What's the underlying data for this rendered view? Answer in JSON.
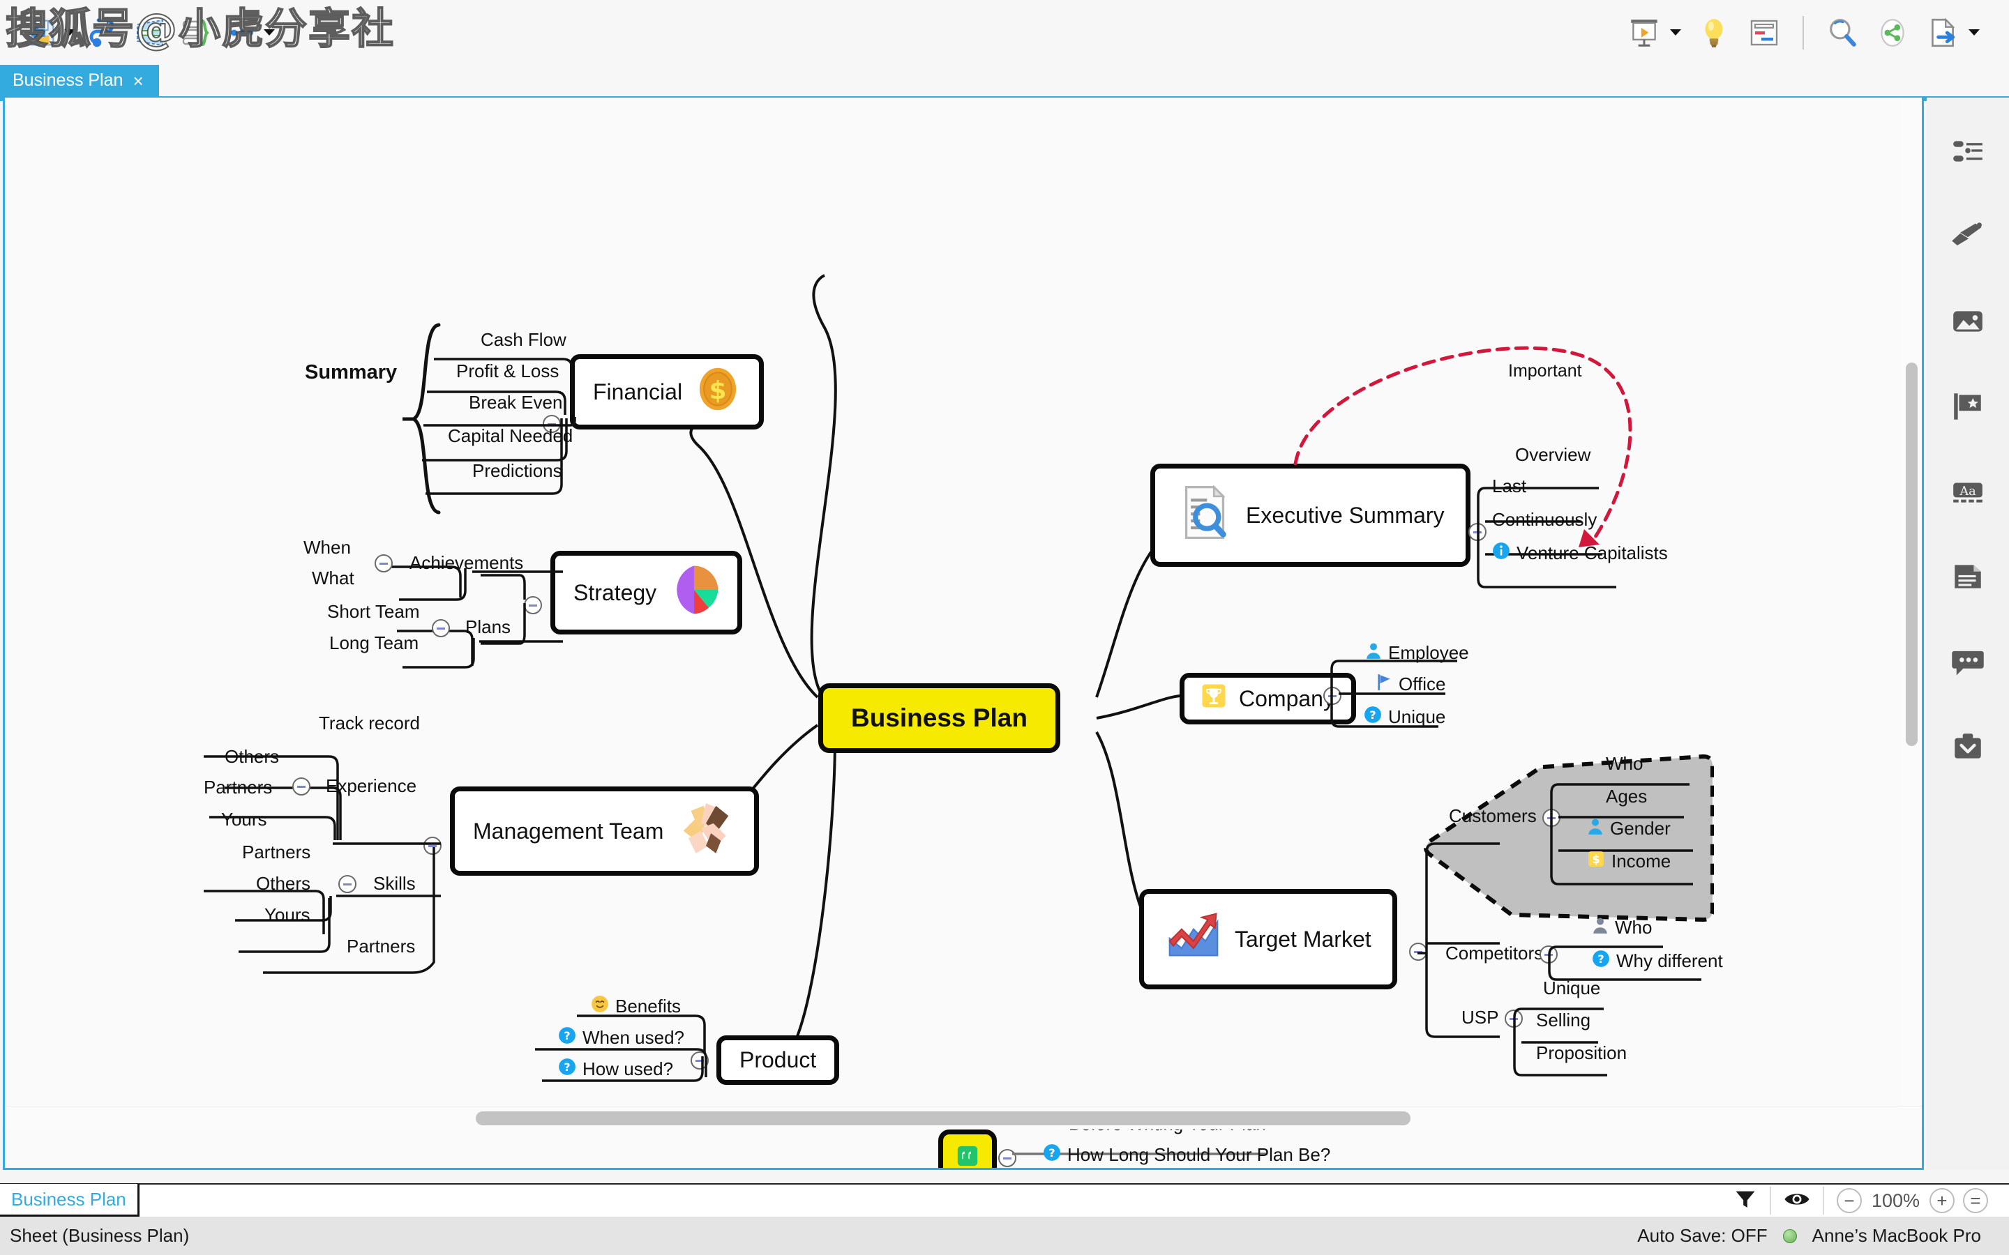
{
  "app": {
    "watermark": "搜狐号@小虎分享社"
  },
  "toolbar": {
    "left_items": [
      {
        "name": "save-icon",
        "label": "Save"
      },
      {
        "name": "relationship-icon",
        "label": "Relationship"
      },
      {
        "name": "boundary-icon",
        "label": "Boundary"
      },
      {
        "name": "summary-icon",
        "label": "Summary"
      },
      {
        "name": "more-icon",
        "label": "More"
      }
    ],
    "right_items": [
      {
        "name": "presentation-icon",
        "label": "Presentation"
      },
      {
        "name": "brainstorm-icon",
        "label": "Brainstorm"
      },
      {
        "name": "outline-icon",
        "label": "Outline"
      },
      {
        "name": "search-icon",
        "label": "Search"
      },
      {
        "name": "share-icon",
        "label": "Share"
      },
      {
        "name": "export-icon",
        "label": "Export"
      }
    ]
  },
  "document_tab": {
    "title": "Business Plan",
    "close_label": "×"
  },
  "sidebar": {
    "items": [
      {
        "name": "properties-icon",
        "label": "Properties"
      },
      {
        "name": "style-brush-icon",
        "label": "Style"
      },
      {
        "name": "image-icon",
        "label": "Image"
      },
      {
        "name": "marker-flag-icon",
        "label": "Markers"
      },
      {
        "name": "text-aa-icon",
        "label": "Text"
      },
      {
        "name": "notes-document-icon",
        "label": "Notes"
      },
      {
        "name": "comment-icon",
        "label": "Comments"
      },
      {
        "name": "task-clipboard-icon",
        "label": "Task"
      }
    ]
  },
  "sheet_bar": {
    "tab_label": "Business Plan",
    "filter_label": "Filter",
    "visibility_label": "Focus",
    "zoom_out_label": "−",
    "zoom_level": "100%",
    "zoom_in_label": "+",
    "fit_label": "="
  },
  "status_bar": {
    "left_text": "Sheet (Business Plan)",
    "auto_save": "Auto Save: OFF",
    "device": "Anne’s MacBook Pro"
  },
  "map": {
    "center": {
      "label": "Business Plan"
    },
    "financial": {
      "label": "Financial",
      "icon": "dollar-coin-icon",
      "children": [
        "Cash Flow",
        "Profit & Loss",
        "Break Even",
        "Capital Needed",
        "Predictions"
      ],
      "boundary_label": "Summary"
    },
    "strategy": {
      "label": "Strategy",
      "icon": "pie-chart-icon",
      "groups": [
        {
          "label": "Achievements",
          "children": [
            "When",
            "What"
          ]
        },
        {
          "label": "Plans",
          "children": [
            "Short Team",
            "Long Team"
          ]
        }
      ]
    },
    "management": {
      "label": "Management Team",
      "icon": "teamwork-hands-icon",
      "children": [
        "Track record",
        "Partners"
      ],
      "groups": [
        {
          "label": "Experience",
          "children": [
            "Others",
            "Partners",
            "Yours"
          ]
        },
        {
          "label": "Skills",
          "children": [
            "Partners",
            "Others",
            "Yours"
          ]
        }
      ]
    },
    "product": {
      "label": "Product",
      "children": [
        {
          "label": "Benefits",
          "icon": "smiley-icon"
        },
        {
          "label": "When used?",
          "icon": "question-icon"
        },
        {
          "label": "How used?",
          "icon": "question-icon"
        }
      ]
    },
    "executive_summary": {
      "label": "Executive Summary",
      "icon": "document-search-icon",
      "children": [
        {
          "label": "Overview",
          "icon": ""
        },
        {
          "label": "Last",
          "icon": ""
        },
        {
          "label": "Continuously",
          "icon": ""
        },
        {
          "label": "Venture Capitalists",
          "icon": "info-icon"
        }
      ],
      "relationship_label": "Important"
    },
    "company": {
      "label": "Company",
      "icon": "trophy-icon",
      "children": [
        {
          "label": "Employee",
          "icon": "person-blue-icon"
        },
        {
          "label": "Office",
          "icon": "flag-blue-icon"
        },
        {
          "label": "Unique",
          "icon": "question-icon"
        }
      ]
    },
    "target_market": {
      "label": "Target Market",
      "icon": "growth-chart-icon",
      "groups": [
        {
          "label": "Customers",
          "children": [
            {
              "label": "Who",
              "icon": ""
            },
            {
              "label": "Ages",
              "icon": ""
            },
            {
              "label": "Gender",
              "icon": "person-blue-icon"
            },
            {
              "label": "Income",
              "icon": "money-icon"
            }
          ]
        },
        {
          "label": "Competitors",
          "children": [
            {
              "label": "Who",
              "icon": "person-grey-icon"
            },
            {
              "label": "Why different",
              "icon": "question-icon"
            }
          ]
        },
        {
          "label": "USP",
          "children": [
            {
              "label": "Unique",
              "icon": ""
            },
            {
              "label": "Selling",
              "icon": ""
            },
            {
              "label": "Proposition",
              "icon": ""
            }
          ]
        }
      ]
    },
    "floating_note": {
      "icon": "quote-icon",
      "children": [
        {
          "label": "Before Writing Your Plan",
          "icon": "star-icon"
        },
        {
          "label": "How Long Should Your Plan Be?",
          "icon": "question-icon"
        }
      ]
    }
  },
  "colors": {
    "accent": "#34abdf",
    "center_node": "#f5ea00",
    "relationship": "#d1173b",
    "boundary_fill": "#c0c0c0"
  }
}
